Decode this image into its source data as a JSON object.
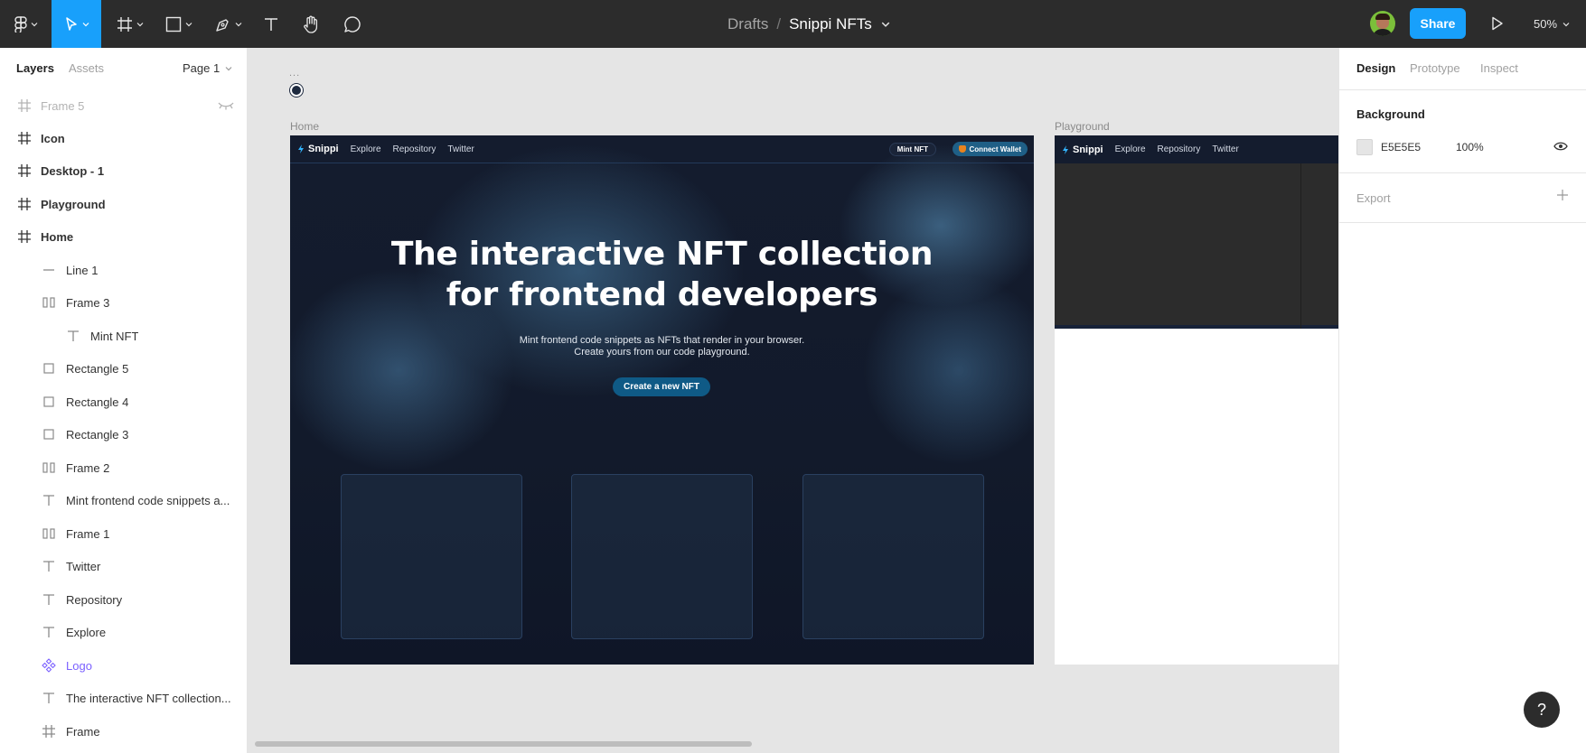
{
  "toolbar": {
    "breadcrumb_drafts": "Drafts",
    "breadcrumb_sep": "/",
    "file_name": "Snippi NFTs",
    "share_label": "Share",
    "zoom": "50%",
    "accent_color": "#18a0fb",
    "tools": [
      "figma-menu-icon",
      "move-tool-icon",
      "frame-tool-icon",
      "shape-tool-icon",
      "pen-tool-icon",
      "text-tool-icon",
      "hand-tool-icon",
      "comment-tool-icon"
    ]
  },
  "left_panel": {
    "tab_layers": "Layers",
    "tab_assets": "Assets",
    "page_label": "Page 1",
    "layers": [
      {
        "name": "Frame 5",
        "icon": "frame-icon"
      },
      {
        "name": "Icon",
        "icon": "frame-icon"
      },
      {
        "name": "Desktop - 1",
        "icon": "frame-icon"
      },
      {
        "name": "Playground",
        "icon": "frame-icon"
      },
      {
        "name": "Home",
        "icon": "frame-icon"
      },
      {
        "name": "Line 1",
        "icon": "line-icon"
      },
      {
        "name": "Frame 3",
        "icon": "auto-layout-icon"
      },
      {
        "name": "Mint NFT",
        "icon": "text-icon"
      },
      {
        "name": "Rectangle 5",
        "icon": "rectangle-icon"
      },
      {
        "name": "Rectangle 4",
        "icon": "rectangle-icon"
      },
      {
        "name": "Rectangle 3",
        "icon": "rectangle-icon"
      },
      {
        "name": "Frame 2",
        "icon": "auto-layout-icon"
      },
      {
        "name": "Mint frontend code snippets a...",
        "icon": "text-icon"
      },
      {
        "name": "Frame 1",
        "icon": "auto-layout-icon"
      },
      {
        "name": "Twitter",
        "icon": "text-icon"
      },
      {
        "name": "Repository",
        "icon": "text-icon"
      },
      {
        "name": "Explore",
        "icon": "text-icon"
      },
      {
        "name": "Logo",
        "icon": "component-icon"
      },
      {
        "name": "The interactive NFT collection...",
        "icon": "text-icon"
      },
      {
        "name": "Frame",
        "icon": "frame-icon"
      }
    ]
  },
  "canvas": {
    "ellipsis": "...",
    "home_label": "Home",
    "playground_label": "Playground",
    "site": {
      "logo_text": "Snippi",
      "nav_explore": "Explore",
      "nav_repository": "Repository",
      "nav_twitter": "Twitter",
      "mint_button": "Mint NFT",
      "wallet_button": "Connect Wallet",
      "hero_line1": "The interactive NFT collection",
      "hero_line2": "for frontend developers",
      "sub_line1": "Mint frontend code snippets as NFTs that render in your browser.",
      "sub_line2": "Create yours from our code playground.",
      "create_button": "Create a new NFT"
    }
  },
  "right_panel": {
    "tab_design": "Design",
    "tab_prototype": "Prototype",
    "tab_inspect": "Inspect",
    "background_title": "Background",
    "background_hex": "E5E5E5",
    "background_opacity": "100%",
    "export_title": "Export",
    "help": "?"
  }
}
